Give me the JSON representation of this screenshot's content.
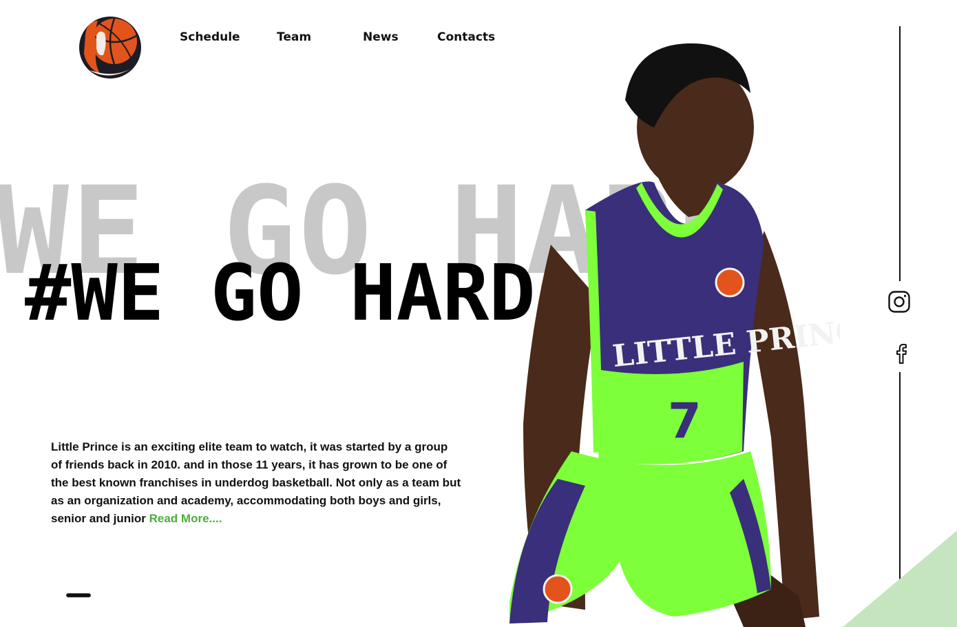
{
  "nav": {
    "items": [
      {
        "label": "Schedule"
      },
      {
        "label": "Team"
      },
      {
        "label": "News"
      },
      {
        "label": "Contacts"
      }
    ]
  },
  "hero": {
    "ghost_text": "WE GO HARD",
    "headline": "#WE GO HARD",
    "intro_text": "Little Prince is an exciting elite team to watch, it was started by a group of friends back in 2010. and in those 11 years, it has grown to be one of the best known franchises in underdog basketball. Not only as a team but as an organization and academy, accommodating both boys and girls, senior and junior ",
    "read_more": "Read More....",
    "jersey_text": "LITTLE PRINCE",
    "jersey_number": "7"
  },
  "social": {
    "icons": [
      "instagram-icon",
      "facebook-icon"
    ]
  },
  "colors": {
    "accent_green": "#4caf3a",
    "neon_green": "#7dff3a",
    "jersey_purple": "#3a2f7a",
    "ghost_gray": "#c8c8c8",
    "triangle_green": "#c5e5bf",
    "logo_orange": "#e2541c"
  }
}
